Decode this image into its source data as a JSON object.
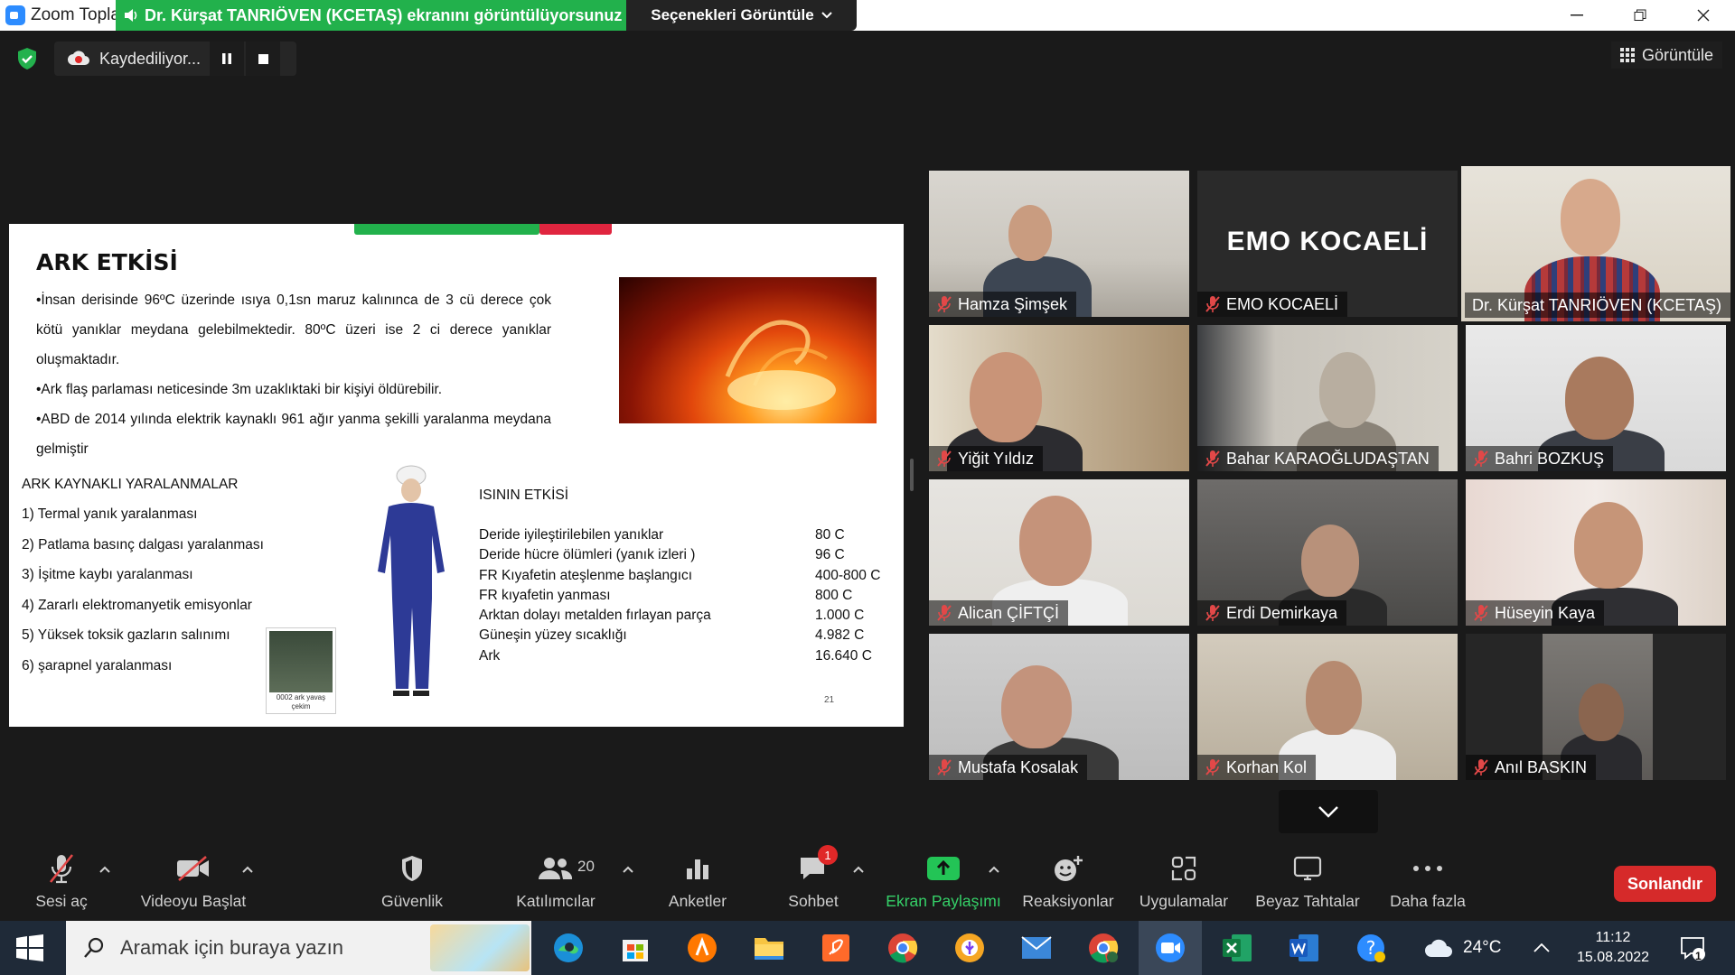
{
  "window": {
    "app_title": "Zoom Topla",
    "share_banner": "Dr. Kürşat TANRIÖVEN (KCETAŞ) ekranını görüntülüyorsunuz",
    "view_options": "Seçenekleri Görüntüle"
  },
  "recording": {
    "label": "Kaydediliyor..."
  },
  "view_button": "Görüntüle",
  "slide": {
    "title": "ARK ETKİSİ",
    "bullets": [
      "•İnsan derisinde 96ºC üzerinde ısıya 0,1sn maruz kalınınca de 3 cü derece çok kötü yanıklar meydana gelebilmektedir. 80ºC üzeri ise 2 ci derece yanıklar oluşmaktadır.",
      "•Ark flaş parlaması neticesinde 3m uzaklıktaki bir kişiyi öldürebilir.",
      "•ABD de 2014 yılında elektrik kaynaklı 961 ağır yanma şekilli yaralanma meydana gelmiştir"
    ],
    "injuries_heading": "ARK KAYNAKLI YARALANMALAR",
    "injuries": [
      "1) Termal yanık yaralanması",
      "2) Patlama basınç dalgası yaralanması",
      "3) İşitme kaybı yaralanması",
      "4) Zararlı elektromanyetik emisyonlar",
      "5) Yüksek toksik gazların salınımı",
      "6) şarapnel yaralanması"
    ],
    "video_caption": "0002 ark yavaş çekim",
    "heat_heading": "ISININ ETKİSİ",
    "heat_rows": [
      {
        "label": "Deride iyileştirilebilen yanıklar",
        "value": "80 C"
      },
      {
        "label": "Deride hücre ölümleri (yanık izleri )",
        "value": "96 C"
      },
      {
        "label": "FR Kıyafetin ateşlenme başlangıcı",
        "value": "400-800 C"
      },
      {
        "label": "FR kıyafetin yanması",
        "value": "800 C"
      },
      {
        "label": "Arktan dolayı metalden fırlayan parça",
        "value": "1.000 C"
      },
      {
        "label": "Güneşin yüzey sıcaklığı",
        "value": "4.982 C"
      },
      {
        "label": "Ark",
        "value": "16.640 C"
      }
    ],
    "page_number": "21"
  },
  "participants": [
    {
      "name": "Hamza Şimşek"
    },
    {
      "name": "EMO KOCAELİ",
      "video_text": "EMO KOCAELİ"
    },
    {
      "name": "Dr. Kürşat TANRIÖVEN (KCETAŞ)"
    },
    {
      "name": "Yiğit Yıldız"
    },
    {
      "name": "Bahar KARAOĞLUDAŞTAN"
    },
    {
      "name": "Bahri BOZKUŞ"
    },
    {
      "name": "Alican ÇİFTÇİ"
    },
    {
      "name": "Erdi Demirkaya"
    },
    {
      "name": "Hüseyin Kaya"
    },
    {
      "name": "Mustafa Kosalak"
    },
    {
      "name": "Korhan Kol"
    },
    {
      "name": "Anıl BASKIN"
    }
  ],
  "toolbar": {
    "unmute": "Sesi aç",
    "start_video": "Videoyu Başlat",
    "security": "Güvenlik",
    "participants": "Katılımcılar",
    "participant_count": "20",
    "polls": "Anketler",
    "chat": "Sohbet",
    "chat_badge": "1",
    "share": "Ekran Paylaşımı",
    "reactions": "Reaksiyonlar",
    "apps": "Uygulamalar",
    "whiteboards": "Beyaz Tahtalar",
    "more": "Daha fazla",
    "end": "Sonlandır"
  },
  "taskbar": {
    "search_placeholder": "Aramak için buraya yazın",
    "weather": "24°C",
    "time": "11:12",
    "date": "15.08.2022",
    "notification_count": "1"
  },
  "colors": {
    "share_green": "#22b14c",
    "end_red": "#d62a2a",
    "active_speaker": "#e6f76e",
    "taskbar": "#1f2a38"
  }
}
